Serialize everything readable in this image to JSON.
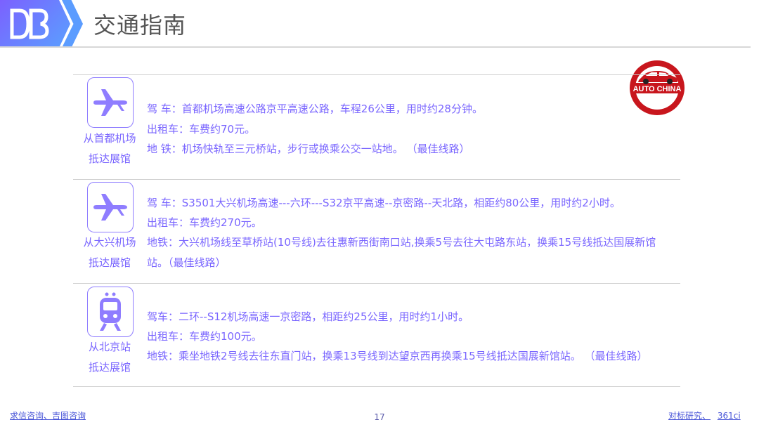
{
  "header": {
    "logo_icon": "db-logo-icon",
    "title": "交通指南"
  },
  "badge": {
    "icon": "car-icon",
    "text": "AUTO CHINA"
  },
  "sections": [
    {
      "icon": "airplane-icon",
      "caption_line1": "从首都机场",
      "caption_line2": "抵达展馆",
      "lines": [
        "驾 车：首都机场高速公路京平高速公路，车程26公里，用时约28分钟。",
        "出租车：车费约70元。",
        "地 铁：机场快轨至三元桥站，步行或换乘公交一站地。 （最佳线路）"
      ]
    },
    {
      "icon": "airplane-icon",
      "caption_line1": "从大兴机场",
      "caption_line2": "抵达展馆",
      "lines": [
        "驾 车：S3501大兴机场高速---六环---S32京平高速--京密路--天北路，相距约80公里，用时约2小时。",
        "出租车：车费约270元。",
        "地铁：大兴机场线至草桥站(10号线)去往惠新西街南口站,换乘5号去往大屯路东站，换乘15号线抵达国展新馆",
        "站。（最佳线路）"
      ]
    },
    {
      "icon": "train-icon",
      "caption_line1": "从北京站",
      "caption_line2": "抵达展馆",
      "lines": [
        "驾车：二环--S12机场高速一京密路，相距约25公里，用时约1小时。",
        "出租车：车费约100元。",
        "地铁：乘坐地铁2号线去往东直门站，换乘13号线到达望京西再换乘15号线抵达国展新馆站。 （最佳线路）"
      ]
    }
  ],
  "footer": {
    "left_link": "求信咨询、吉图咨询",
    "page_number": "17",
    "right_link_1": "对标研究、",
    "right_link_2": "361ci"
  },
  "colors": {
    "accent": "#7a66ff",
    "icon": "#8f7dff",
    "badge_red": "#c8161d"
  }
}
